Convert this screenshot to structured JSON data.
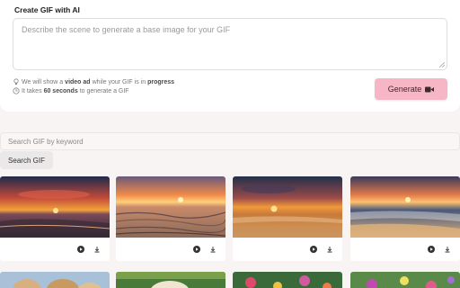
{
  "create": {
    "title": "Create GIF with AI",
    "prompt_placeholder": "Describe the scene to generate a base image for your GIF",
    "notice1": {
      "pre": "We will show a",
      "b1": "video ad",
      "mid": "while your GIF is in",
      "b2": "progress"
    },
    "notice2": {
      "pre": "It takes",
      "b1": "60 seconds",
      "post": "to generate a GIF"
    },
    "generate_label": "Generate"
  },
  "search": {
    "placeholder": "Search GIF by keyword",
    "button_label": "Search GIF"
  },
  "gallery": {
    "row1": [
      "sunset-beach-1",
      "sunset-beach-2",
      "sunset-beach-3",
      "sunset-beach-4"
    ],
    "row2": [
      "dogs",
      "puppy",
      "flowers-1",
      "flowers-2"
    ]
  },
  "colors": {
    "accent": "#f7b6c6",
    "background": "#f7f4f3"
  },
  "icons": [
    "bulb-icon",
    "clock-icon",
    "video-camera-icon",
    "play-icon",
    "download-icon"
  ]
}
